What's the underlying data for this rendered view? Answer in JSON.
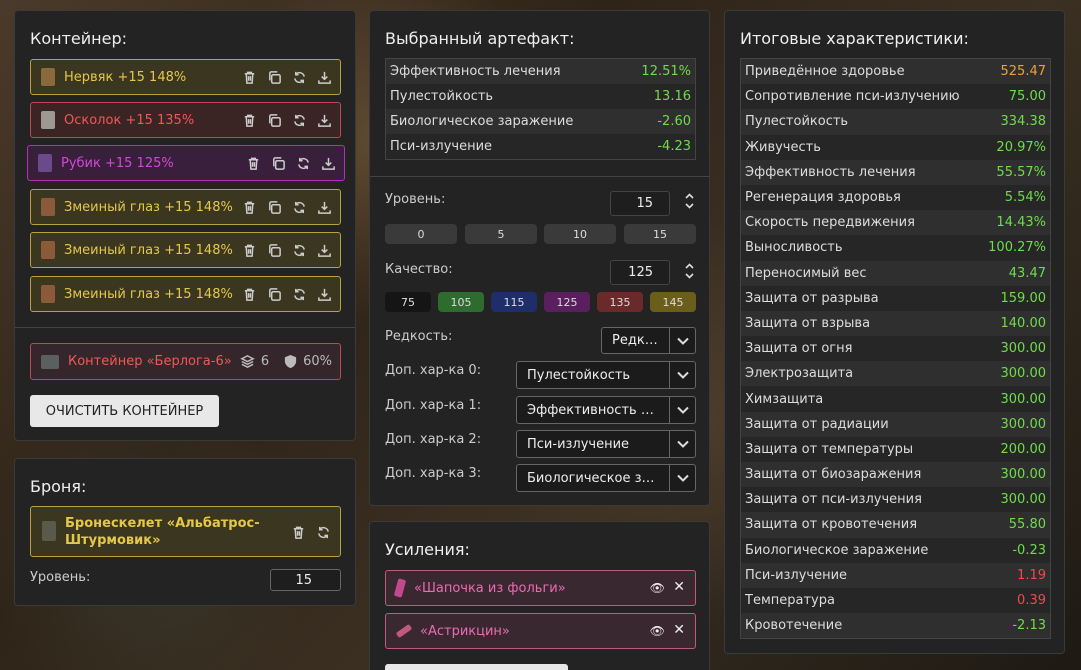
{
  "container": {
    "title": "Контейнер:",
    "items": [
      {
        "label": "Нервяк +15 148%",
        "style": "gold",
        "icon_color": "#8a6a3a"
      },
      {
        "label": "Осколок +15 135%",
        "style": "red",
        "icon_color": "#9a9a90"
      },
      {
        "label": "Рубик +15 125%",
        "style": "purple",
        "icon_color": "#6a4a8a"
      },
      {
        "label": "Змеиный глаз +15 148%",
        "style": "gold",
        "icon_color": "#8a5a3a"
      },
      {
        "label": "Змеиный глаз +15 148%",
        "style": "gold",
        "icon_color": "#8a5a3a"
      },
      {
        "label": "Змеиный глаз +15 148%",
        "style": "gold",
        "icon_color": "#8a5a3a"
      }
    ],
    "box": {
      "label": "Контейнер «Берлога-6»",
      "slots": "6",
      "protection": "60%"
    },
    "clear_button": "ОЧИСТИТЬ КОНТЕЙНЕР"
  },
  "armor": {
    "title": "Броня:",
    "name": "Бронескелет «Альбатрос-Штурмовик»",
    "level_label": "Уровень:",
    "level_value": "15"
  },
  "artifact": {
    "title": "Выбранный артефакт:",
    "stats": [
      {
        "name": "Эффективность лечения",
        "value": "12.51%",
        "color": "green"
      },
      {
        "name": "Пулестойкость",
        "value": "13.16",
        "color": "green"
      },
      {
        "name": "Биологическое заражение",
        "value": "-2.60",
        "color": "green"
      },
      {
        "name": "Пси-излучение",
        "value": "-4.23",
        "color": "green"
      }
    ],
    "level_label": "Уровень:",
    "level_value": "15",
    "level_presets": [
      "0",
      "5",
      "10",
      "15"
    ],
    "quality_label": "Качество:",
    "quality_value": "125",
    "quality_presets": [
      {
        "label": "75",
        "color": "#1a1a1a"
      },
      {
        "label": "105",
        "color": "#2e6b2e"
      },
      {
        "label": "115",
        "color": "#1f2e6b"
      },
      {
        "label": "125",
        "color": "#5a1f5e"
      },
      {
        "label": "135",
        "color": "#6b2a2a"
      },
      {
        "label": "145",
        "color": "#6b5e1a"
      }
    ],
    "rarity_label": "Редкость:",
    "rarity_value": "Редкий",
    "extra": [
      {
        "label": "Доп. хар-ка 0:",
        "value": "Пулестойкость"
      },
      {
        "label": "Доп. хар-ка 1:",
        "value": "Эффективность лечения"
      },
      {
        "label": "Доп. хар-ка 2:",
        "value": "Пси-излучение"
      },
      {
        "label": "Доп. хар-ка 3:",
        "value": "Биологическое заражение"
      }
    ]
  },
  "boosts": {
    "title": "Усиления:",
    "items": [
      {
        "label": "«Шапочка из фольги»",
        "icon_color": "#c04a8a"
      },
      {
        "label": "«Астрикцин»",
        "icon_color": "#c05a7a"
      }
    ]
  },
  "totals": {
    "title": "Итоговые характеристики:",
    "stats": [
      {
        "name": "Приведённое здоровье",
        "value": "525.47",
        "color": "orange"
      },
      {
        "name": "Сопротивление пси-излучению",
        "value": "75.00",
        "color": "green"
      },
      {
        "name": "Пулестойкость",
        "value": "334.38",
        "color": "green"
      },
      {
        "name": "Живучесть",
        "value": "20.97%",
        "color": "green"
      },
      {
        "name": "Эффективность лечения",
        "value": "55.57%",
        "color": "green"
      },
      {
        "name": "Регенерация здоровья",
        "value": "5.54%",
        "color": "green"
      },
      {
        "name": "Скорость передвижения",
        "value": "14.43%",
        "color": "green"
      },
      {
        "name": "Выносливость",
        "value": "100.27%",
        "color": "green"
      },
      {
        "name": "Переносимый вес",
        "value": "43.47",
        "color": "green"
      },
      {
        "name": "Защита от разрыва",
        "value": "159.00",
        "color": "green"
      },
      {
        "name": "Защита от взрыва",
        "value": "140.00",
        "color": "green"
      },
      {
        "name": "Защита от огня",
        "value": "300.00",
        "color": "green"
      },
      {
        "name": "Электрозащита",
        "value": "300.00",
        "color": "green"
      },
      {
        "name": "Химзащита",
        "value": "300.00",
        "color": "green"
      },
      {
        "name": "Защита от радиации",
        "value": "300.00",
        "color": "green"
      },
      {
        "name": "Защита от температуры",
        "value": "200.00",
        "color": "green"
      },
      {
        "name": "Защита от биозаражения",
        "value": "300.00",
        "color": "green"
      },
      {
        "name": "Защита от пси-излучения",
        "value": "300.00",
        "color": "green"
      },
      {
        "name": "Защита от кровотечения",
        "value": "55.80",
        "color": "green"
      },
      {
        "name": "Биологическое заражение",
        "value": "-0.23",
        "color": "green"
      },
      {
        "name": "Пси-излучение",
        "value": "1.19",
        "color": "red"
      },
      {
        "name": "Температура",
        "value": "0.39",
        "color": "red"
      },
      {
        "name": "Кровотечение",
        "value": "-2.13",
        "color": "green"
      }
    ]
  }
}
